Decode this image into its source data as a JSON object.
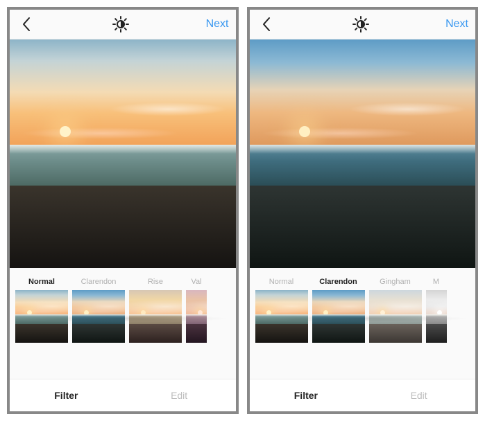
{
  "screens": [
    {
      "header": {
        "next_label": "Next"
      },
      "preview_variant": "v-normal",
      "filters": [
        {
          "label": "Normal",
          "variant": "v-normal",
          "selected": true
        },
        {
          "label": "Clarendon",
          "variant": "v-clarendon",
          "selected": false
        },
        {
          "label": "Rise",
          "variant": "v-rise",
          "selected": false
        },
        {
          "label": "Val",
          "variant": "v-valencia",
          "selected": false,
          "cut": true
        }
      ],
      "tabs": {
        "filter_label": "Filter",
        "edit_label": "Edit",
        "active": "filter"
      }
    },
    {
      "header": {
        "next_label": "Next"
      },
      "preview_variant": "v-clarendon",
      "filters": [
        {
          "label": "Normal",
          "variant": "v-normal",
          "selected": false
        },
        {
          "label": "Clarendon",
          "variant": "v-clarendon",
          "selected": true
        },
        {
          "label": "Gingham",
          "variant": "v-gingham",
          "selected": false
        },
        {
          "label": "M",
          "variant": "v-moon",
          "selected": false,
          "cut": true
        }
      ],
      "tabs": {
        "filter_label": "Filter",
        "edit_label": "Edit",
        "active": "filter"
      }
    }
  ]
}
